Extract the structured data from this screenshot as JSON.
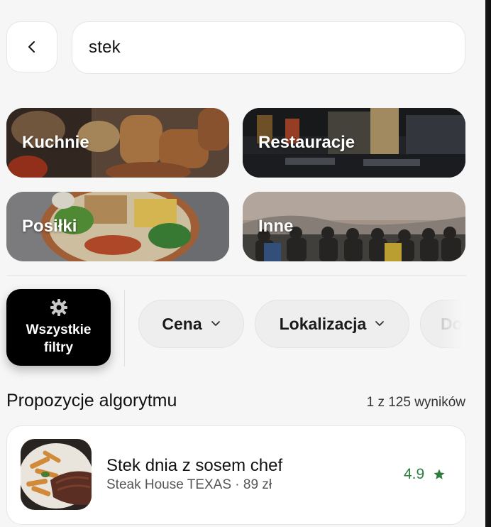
{
  "search": {
    "value": "stek"
  },
  "categories": [
    {
      "label": "Kuchnie"
    },
    {
      "label": "Restauracje"
    },
    {
      "label": "Posiłki"
    },
    {
      "label": "Inne"
    }
  ],
  "filters": {
    "all_filters_label": "Wszystkie\nfiltry",
    "chips": [
      {
        "label": "Cena"
      },
      {
        "label": "Lokalizacja"
      },
      {
        "label": "Do"
      }
    ]
  },
  "section": {
    "title": "Propozycje algorytmu",
    "results_count": "1 z 125 wyników"
  },
  "results": [
    {
      "title": "Stek dnia z sosem chef",
      "subtitle": "Steak House TEXAS · 89 zł",
      "rating": "4.9"
    }
  ],
  "colors": {
    "rating_green": "#2e7d3e",
    "filter_dark": "#000000",
    "background": "#f6f6f6"
  }
}
